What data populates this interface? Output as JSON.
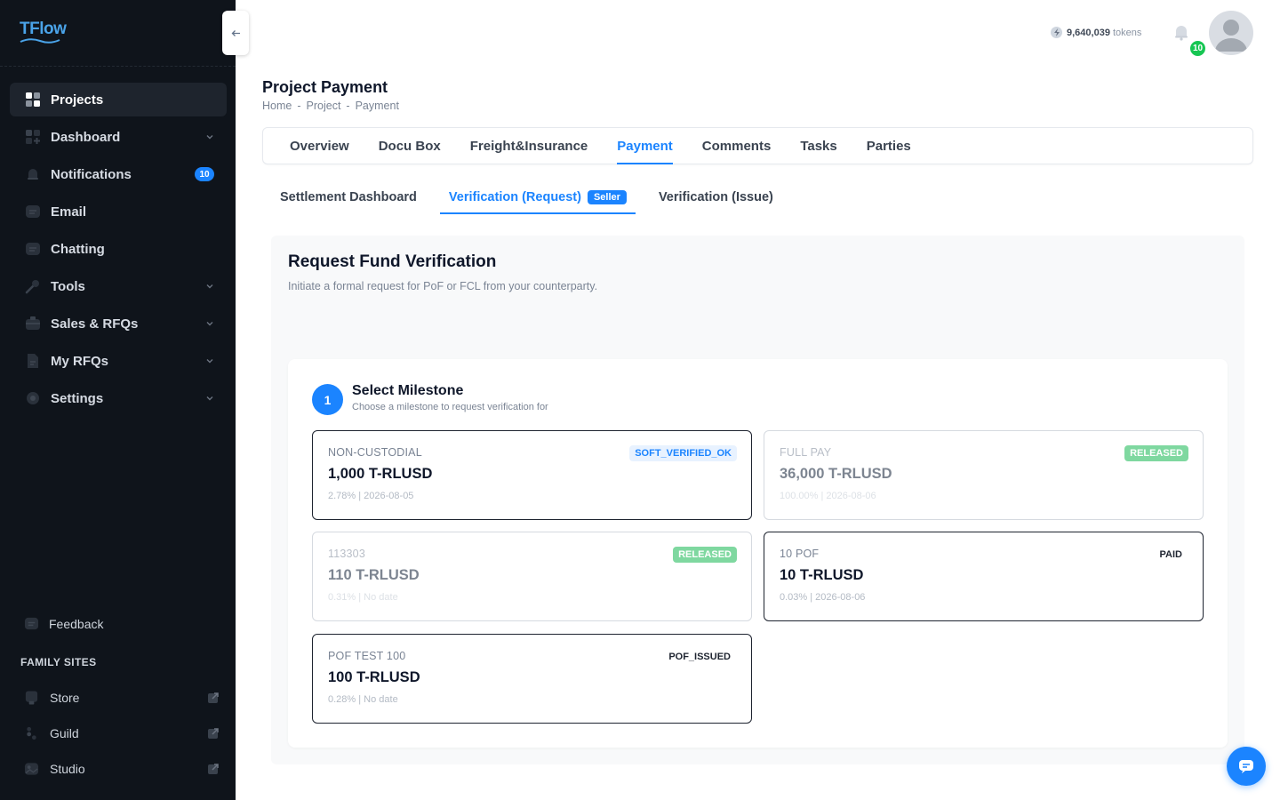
{
  "app": {
    "logo_text": "TFlow"
  },
  "sidebar": {
    "items": [
      {
        "label": "Projects",
        "active": true
      },
      {
        "label": "Dashboard",
        "expandable": true
      },
      {
        "label": "Notifications",
        "badge": "10"
      },
      {
        "label": "Email"
      },
      {
        "label": "Chatting"
      },
      {
        "label": "Tools",
        "expandable": true
      },
      {
        "label": "Sales & RFQs",
        "expandable": true
      },
      {
        "label": "My RFQs",
        "expandable": true
      },
      {
        "label": "Settings",
        "expandable": true
      }
    ],
    "feedback_label": "Feedback",
    "family_sites_title": "FAMILY SITES",
    "family_sites": [
      {
        "label": "Store"
      },
      {
        "label": "Guild"
      },
      {
        "label": "Studio"
      }
    ]
  },
  "topbar": {
    "tokens_value": "9,640,039",
    "tokens_unit": "tokens",
    "notification_count": "10"
  },
  "header": {
    "title": "Project Payment",
    "breadcrumb": [
      "Home",
      "Project",
      "Payment"
    ],
    "breadcrumb_sep": "-"
  },
  "main_tabs": [
    {
      "label": "Overview"
    },
    {
      "label": "Docu Box"
    },
    {
      "label": "Freight&Insurance"
    },
    {
      "label": "Payment",
      "active": true
    },
    {
      "label": "Comments"
    },
    {
      "label": "Tasks"
    },
    {
      "label": "Parties"
    }
  ],
  "sub_tabs": [
    {
      "label": "Settlement Dashboard"
    },
    {
      "label": "Verification (Request)",
      "badge": "Seller",
      "active": true
    },
    {
      "label": "Verification (Issue)"
    }
  ],
  "panel": {
    "title": "Request Fund Verification",
    "subtitle": "Initiate a formal request for PoF or FCL from your counterparty."
  },
  "step": {
    "number": "1",
    "title": "Select Milestone",
    "subtitle": "Choose a milestone to request verification for"
  },
  "milestones": [
    {
      "name": "NON-CUSTODIAL",
      "amount": "1,000 T-RLUSD",
      "meta": "2.78% | 2026-08-05",
      "status": "SOFT_VERIFIED_OK"
    },
    {
      "name": "FULL PAY",
      "amount": "36,000 T-RLUSD",
      "meta": "100.00% | 2026-08-06",
      "status": "RELEASED"
    },
    {
      "name": "113303",
      "amount": "110 T-RLUSD",
      "meta": "0.31% | No date",
      "status": "RELEASED"
    },
    {
      "name": "10 POF",
      "amount": "10 T-RLUSD",
      "meta": "0.03% | 2026-08-06",
      "status": "PAID"
    },
    {
      "name": "POF TEST 100",
      "amount": "100 T-RLUSD",
      "meta": "0.28% | No date",
      "status": "POF_ISSUED"
    }
  ],
  "colors": {
    "accent": "#1b84ff",
    "sidebar_bg": "#0f141b",
    "success": "#17c653"
  }
}
